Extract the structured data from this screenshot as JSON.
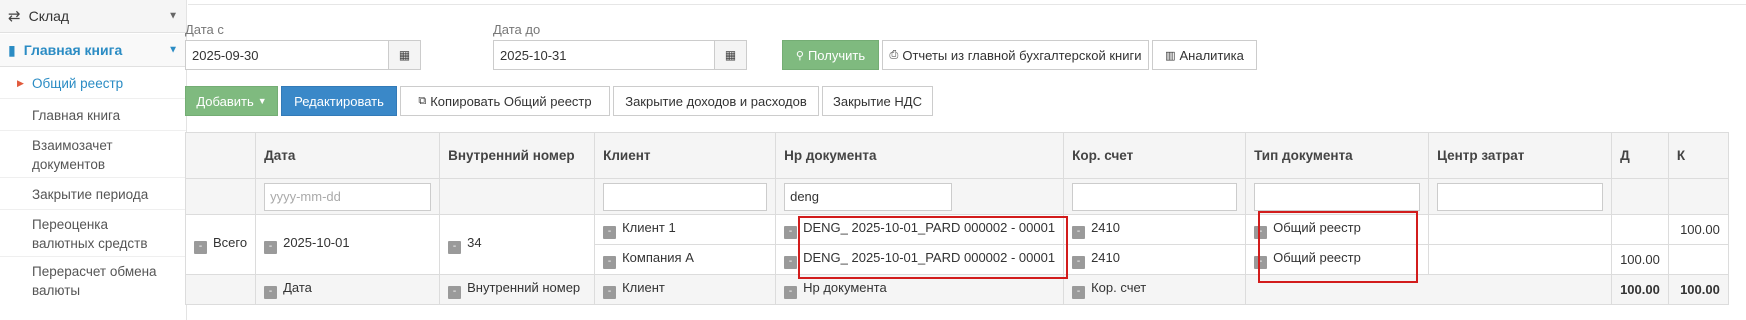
{
  "sidebar": {
    "top_item": "Склад",
    "section": "Главная книга",
    "items": [
      "Общий реестр",
      "Главная книга",
      "Взаимозачет документов",
      "Закрытие периода",
      "Переоценка валютных средств",
      "Перерасчет обмена валюты"
    ],
    "active_item": "Общий реестр"
  },
  "filters": {
    "date_from_label": "Дата с",
    "date_from_value": "2025-09-30",
    "date_to_label": "Дата до",
    "date_to_value": "2025-10-31"
  },
  "toolbar": {
    "get_label": "Получить",
    "reports_label": "Отчеты из главной бухгалтерской книги",
    "analytics_label": "Аналитика",
    "add_label": "Добавить",
    "edit_label": "Редактировать",
    "copy_label": "Копировать Общий реестр",
    "close_income_label": "Закрытие доходов и расходов",
    "close_vat_label": "Закрытие НДС"
  },
  "table": {
    "headers": [
      "",
      "Дата",
      "Внутренний номер",
      "Клиент",
      "Нр документа",
      "Кор. счет",
      "Тип документа",
      "Центр затрат",
      "Д",
      "К"
    ],
    "filter_values": {
      "date_placeholder": "yyyy-mm-dd",
      "doc_number": "deng"
    },
    "group": {
      "label": "Всего",
      "date": "2025-10-01",
      "internal_number": "34"
    },
    "rows": [
      {
        "client": "Клиент 1",
        "doc_number": "DENG_ 2025-10-01_PARD 000002 - 00001",
        "account": "2410",
        "doc_type": "Общий реестр",
        "debit": "",
        "credit": "100.00"
      },
      {
        "client": "Компания А",
        "doc_number": "DENG_ 2025-10-01_PARD 000002 - 00001",
        "account": "2410",
        "doc_type": "Общий реестр",
        "debit": "100.00",
        "credit": ""
      }
    ],
    "footer": {
      "date": "Дата",
      "internal_number": "Внутренний номер",
      "client": "Клиент",
      "doc_number": "Нр документа",
      "account": "Кор. счет",
      "debit_total": "100.00",
      "credit_total": "100.00"
    }
  },
  "colors": {
    "accent": "#2b8cc4",
    "green_button": "#7fba7f",
    "blue_button": "#3a88c8",
    "highlight": "#d21c1c"
  }
}
